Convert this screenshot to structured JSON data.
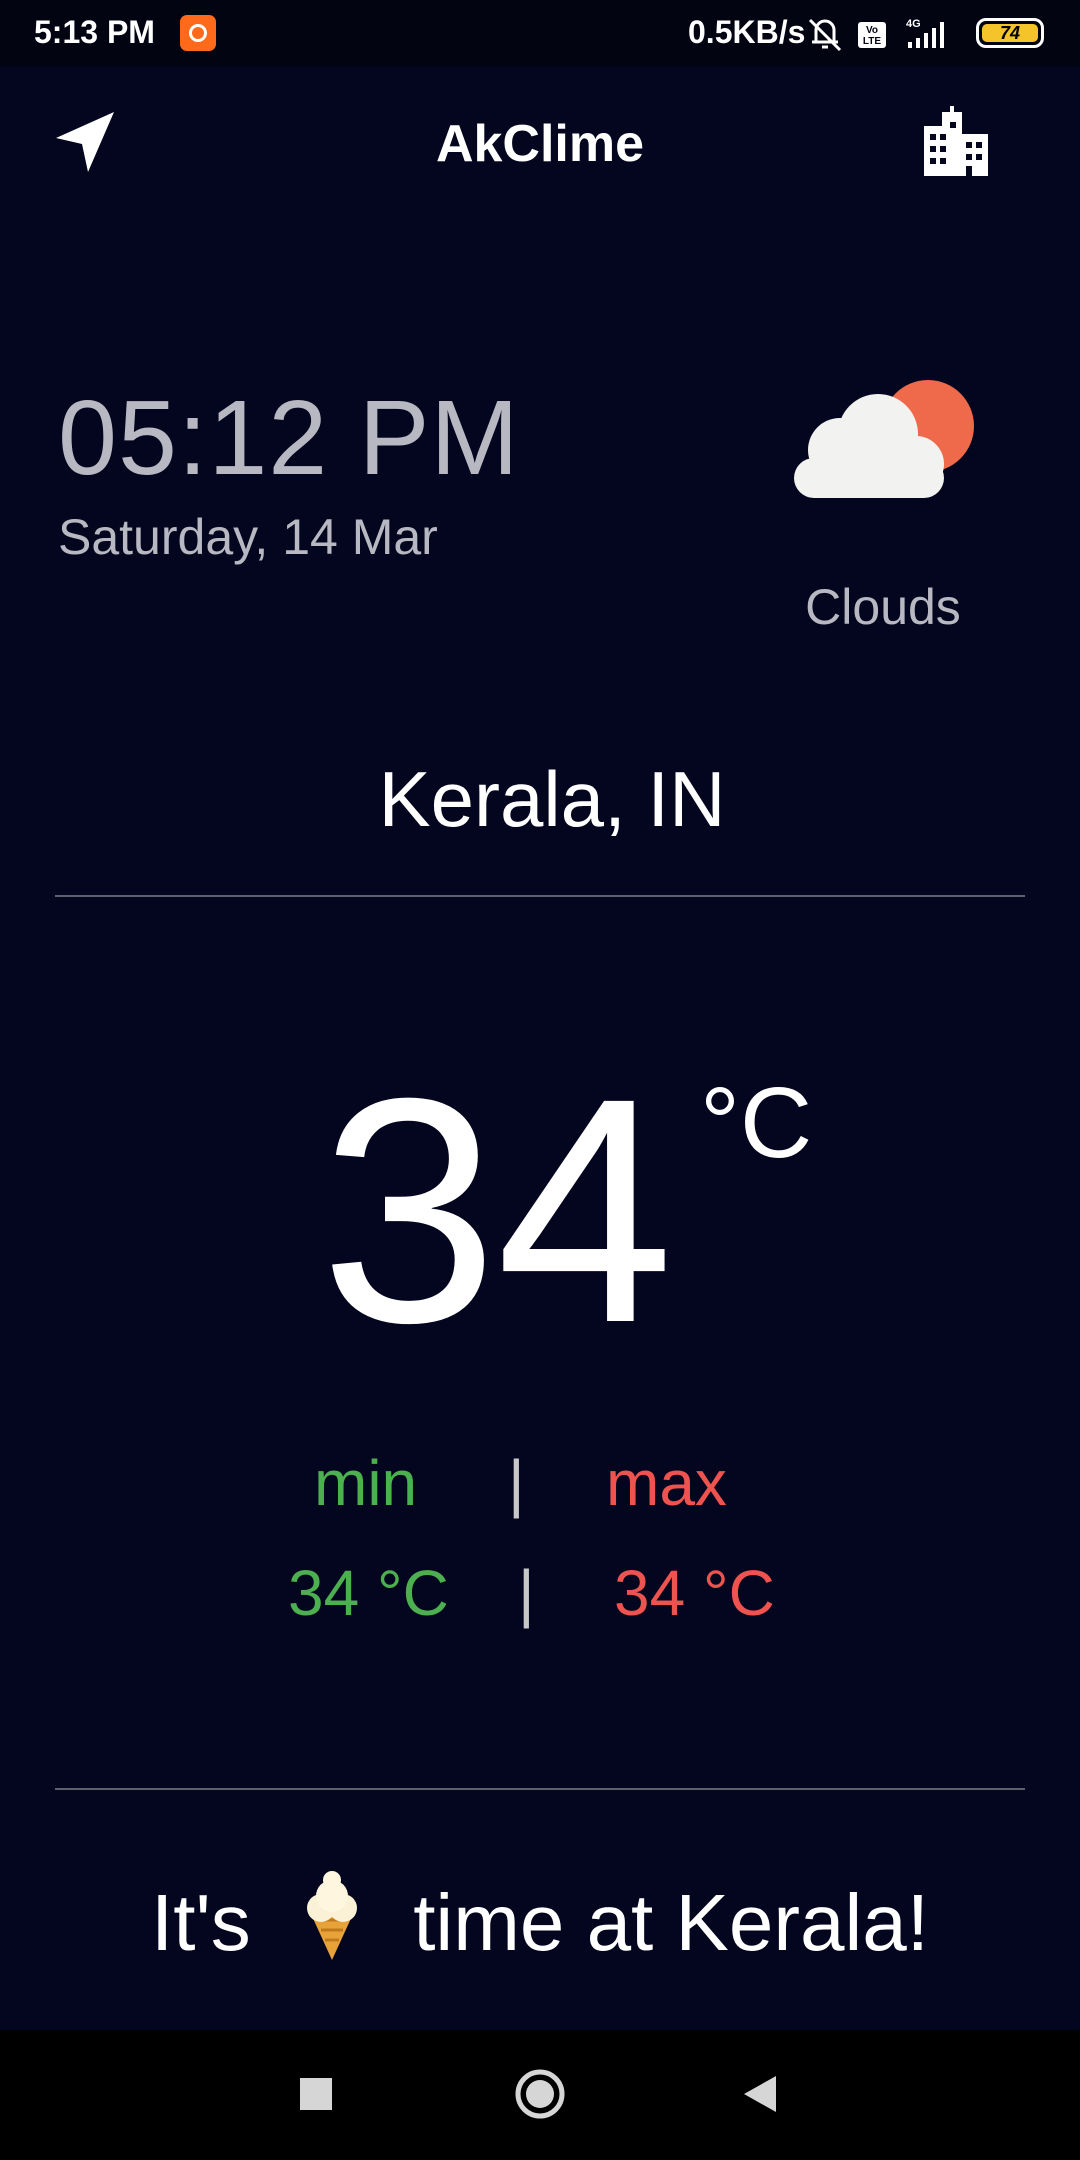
{
  "status_bar": {
    "time": "5:13 PM",
    "net_speed": "0.5KB/s",
    "network": "4G",
    "volte": "Vo LTE",
    "battery": "74"
  },
  "app_bar": {
    "title": "AkClime",
    "left_icon": "navigation-arrow-icon",
    "right_icon": "city-buildings-icon"
  },
  "current": {
    "time": "05:12 PM",
    "date": "Saturday, 14 Mar",
    "condition": "Clouds",
    "condition_icon": "cloud-sun-icon",
    "location": "Kerala, IN",
    "temperature": "34",
    "unit": "°C"
  },
  "range": {
    "min_label": "min",
    "max_label": "max",
    "separator": "|",
    "min_value": "34 °C",
    "max_value": "34 °C"
  },
  "message": {
    "before": "It's",
    "icon": "ice-cream-icon",
    "after": "time at Kerala!"
  },
  "colors": {
    "background": "#03061e",
    "min": "#4caf50",
    "max": "#ef5350",
    "sun": "#ee6a4a"
  }
}
